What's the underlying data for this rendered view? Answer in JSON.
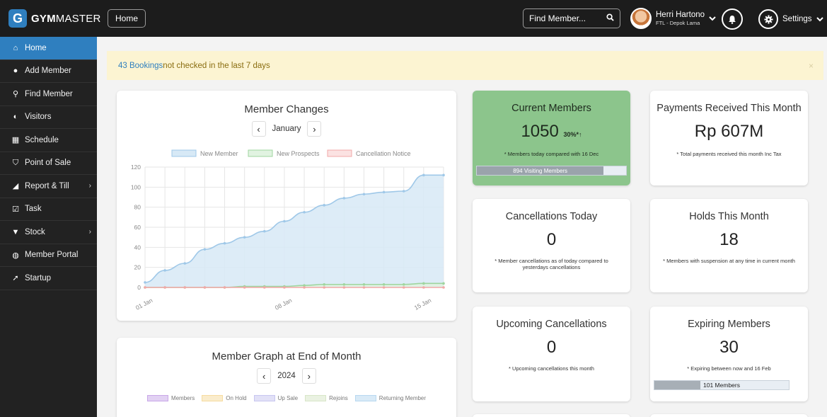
{
  "header": {
    "logo_letter": "G",
    "logo_bold": "GYM",
    "logo_rest": "MASTER",
    "home_label": "Home",
    "find_placeholder": "Find Member...",
    "user_name": "Herri Hartono",
    "user_sub": "FTL - Depok Lama",
    "settings_label": "Settings"
  },
  "sidebar": {
    "items": [
      {
        "label": "Home",
        "icon": "home-icon",
        "active": true
      },
      {
        "label": "Add Member",
        "icon": "user-icon"
      },
      {
        "label": "Find Member",
        "icon": "search-icon"
      },
      {
        "label": "Visitors",
        "icon": "visitor-icon"
      },
      {
        "label": "Schedule",
        "icon": "calendar-icon"
      },
      {
        "label": "Point of Sale",
        "icon": "cart-icon"
      },
      {
        "label": "Report & Till",
        "icon": "chart-icon",
        "arrow": true
      },
      {
        "label": "Task",
        "icon": "task-icon"
      },
      {
        "label": "Stock",
        "icon": "shirt-icon",
        "arrow": true
      },
      {
        "label": "Member Portal",
        "icon": "globe-icon"
      },
      {
        "label": "Startup",
        "icon": "rocket-icon"
      }
    ]
  },
  "alert": {
    "count": "43 Bookings",
    "text": " not checked in the last 7 days",
    "close": "×"
  },
  "member_changes": {
    "title": "Member Changes",
    "period": "January",
    "prev": "‹",
    "next": "›"
  },
  "member_graph": {
    "title": "Member Graph at End of Month",
    "period": "2024",
    "prev": "‹",
    "next": "›",
    "legend": [
      {
        "label": "Members",
        "color": "#c9a8e8"
      },
      {
        "label": "On Hold",
        "color": "#f6dca0"
      },
      {
        "label": "Up Sale",
        "color": "#c8c6f0"
      },
      {
        "label": "Rejoins",
        "color": "#d8e6c8"
      },
      {
        "label": "Returning Member",
        "color": "#b8d8f0"
      }
    ]
  },
  "stats": {
    "current_members": {
      "title": "Current Members",
      "value": "1050",
      "pct": "30%*↑",
      "note": "* Members today compared with 16 Dec",
      "bar_label": "894 Visiting Members",
      "bar_fraction": 0.85
    },
    "payments": {
      "title": "Payments Received This Month",
      "value": "Rp 607M",
      "note": "* Total payments received this month Inc Tax"
    },
    "cancellations_today": {
      "title": "Cancellations Today",
      "value": "0",
      "note": "* Member cancellations as of today compared to yesterdays cancellations"
    },
    "holds": {
      "title": "Holds This Month",
      "value": "18",
      "note": "* Members with suspension at any time in current month"
    },
    "upcoming": {
      "title": "Upcoming Cancellations",
      "value": "0",
      "note": "* Upcoming cancellations this month"
    },
    "expiring": {
      "title": "Expiring Members",
      "value": "30",
      "note": "* Expiring between now and 16 Feb",
      "bar_label": "101 Members",
      "bar_fraction": 0.34
    }
  },
  "chart_data": {
    "type": "area",
    "x": [
      "01 Jan",
      "02 Jan",
      "03 Jan",
      "04 Jan",
      "05 Jan",
      "06 Jan",
      "07 Jan",
      "08 Jan",
      "09 Jan",
      "10 Jan",
      "11 Jan",
      "12 Jan",
      "13 Jan",
      "14 Jan",
      "15 Jan",
      "16 Jan"
    ],
    "x_tick_labels": [
      "01 Jan",
      "08 Jan",
      "15 Jan"
    ],
    "ylim": [
      0,
      120
    ],
    "y_ticks": [
      0,
      20,
      40,
      60,
      80,
      100,
      120
    ],
    "grid": true,
    "legend_position": "top",
    "series": [
      {
        "name": "New Member",
        "color": "#9fc8e8",
        "fill": "#d7e9f6",
        "values": [
          5,
          17,
          24,
          38,
          44,
          50,
          56,
          66,
          75,
          82,
          89,
          93,
          95,
          96,
          112,
          112
        ]
      },
      {
        "name": "New Prospects",
        "color": "#9fd59f",
        "fill": "#e1f3e1",
        "values": [
          0,
          0,
          0,
          0,
          0,
          1,
          1,
          1,
          2,
          3,
          3,
          3,
          3,
          3,
          4,
          4
        ]
      },
      {
        "name": "Cancellation Notice",
        "color": "#f2a8a8",
        "fill": "#fbe2e2",
        "values": [
          0,
          0,
          0,
          0,
          0,
          0,
          0,
          0,
          0,
          0,
          0,
          0,
          0,
          0,
          0,
          0
        ]
      }
    ]
  }
}
